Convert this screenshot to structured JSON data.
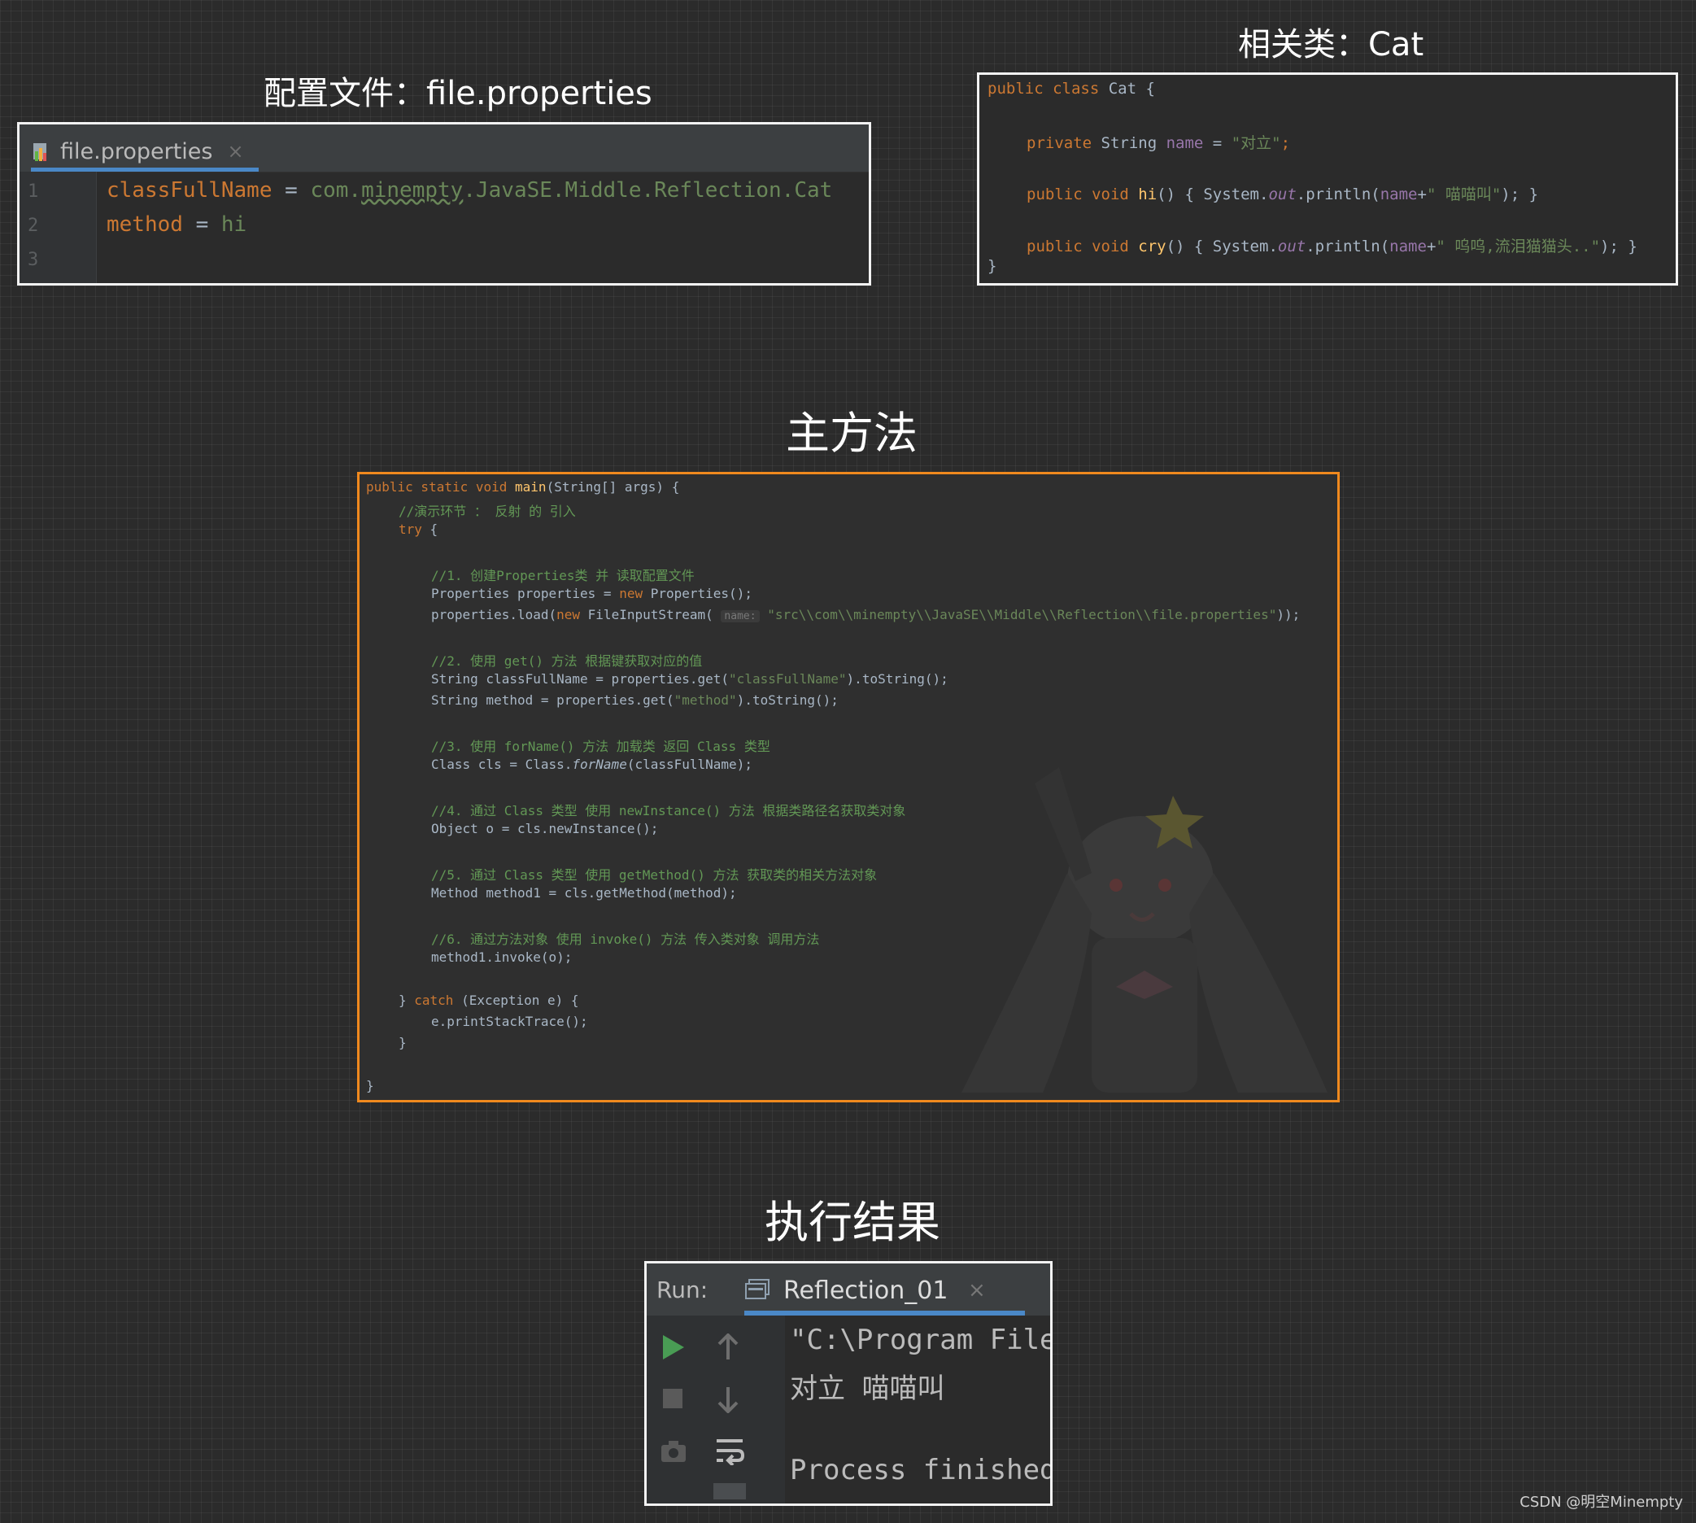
{
  "titles": {
    "config": "配置文件：file.properties",
    "cat": "相关类：Cat",
    "main": "主方法",
    "result": "执行结果"
  },
  "properties_panel": {
    "tab_label": "file.properties",
    "tab_close": "×",
    "line_numbers": [
      "1",
      "2",
      "3"
    ],
    "line1_key": "classFullName",
    "line1_eq": " = ",
    "line1_val_prefix": "com.",
    "line1_val_underlined": "minempty",
    "line1_val_suffix": ".JavaSE.Middle.Reflection.Cat",
    "line2_key": "method",
    "line2_eq": " = ",
    "line2_val": "hi"
  },
  "cat_panel": {
    "l1_kw": "public class ",
    "l1_name": "Cat {",
    "l2_kw": "private ",
    "l2_type": "String ",
    "l2_field": "name",
    "l2_eq": " = ",
    "l2_str": "\"对立\"",
    "l2_semi": ";",
    "l3_kw": "public void ",
    "l3_fn": "hi",
    "l3_a": "() { System.",
    "l3_out": "out",
    "l3_b": ".println(",
    "l3_field": "name",
    "l3_c": "+",
    "l3_str": "\" 喵喵叫\"",
    "l3_d": "); }",
    "l4_kw": "public void ",
    "l4_fn": "cry",
    "l4_a": "() { System.",
    "l4_out": "out",
    "l4_b": ".println(",
    "l4_field": "name",
    "l4_c": "+",
    "l4_str": "\" 呜呜,流泪猫猫头..\"",
    "l4_d": "); }",
    "l5": "}"
  },
  "main_panel": {
    "l1_kw": "public static void ",
    "l1_fn": "main",
    "l1_rest": "(String[] args) {",
    "l2": "//演示环节 ： 反射 的 引入",
    "l3_kw": "try",
    "l3_rest": " {",
    "l4": "//1. 创建Properties类 并 读取配置文件",
    "l5_a": "Properties properties = ",
    "l5_kw": "new",
    "l5_b": " Properties();",
    "l6_a": "properties.load(",
    "l6_kw": "new",
    "l6_b": " FileInputStream( ",
    "l6_hint": "name:",
    "l6_str": " \"src\\\\com\\\\minempty\\\\JavaSE\\\\Middle\\\\Reflection\\\\file.properties\"",
    "l6_c": "));",
    "l7": "//2. 使用 get() 方法 根据键获取对应的值",
    "l8_a": "String classFullName = properties.get(",
    "l8_str": "\"classFullName\"",
    "l8_b": ").toString();",
    "l9_a": "String method = properties.get(",
    "l9_str": "\"method\"",
    "l9_b": ").toString();",
    "l10": "//3. 使用 forName() 方法 加载类 返回 Class 类型",
    "l11_a": "Class cls = Class.",
    "l11_it": "forName",
    "l11_b": "(classFullName);",
    "l12": "//4. 通过 Class 类型 使用 newInstance() 方法 根据类路径名获取类对象",
    "l13": "Object o = cls.newInstance();",
    "l14": "//5. 通过 Class 类型 使用 getMethod() 方法 获取类的相关方法对象",
    "l15": "Method method1 = cls.getMethod(method);",
    "l16": "//6. 通过方法对象 使用 invoke() 方法 传入类对象 调用方法",
    "l17": "method1.invoke(o);",
    "l18_a": "} ",
    "l18_kw": "catch",
    "l18_b": " (Exception e) {",
    "l19": "e.printStackTrace();",
    "l20": "}",
    "l21": "}"
  },
  "run_panel": {
    "run_label": "Run:",
    "tab_label": "Reflection_01",
    "tab_close": "×",
    "out1": "\"C:\\Program Files",
    "out2": "对立 喵喵叫",
    "out3": "Process finished"
  },
  "watermark": "CSDN @明空Minempty",
  "colors": {
    "background": "#2b2b2b",
    "accent_border": "#f0891e",
    "keyword": "#cc7832",
    "string": "#6a8759",
    "comment": "#629755",
    "function": "#ffc66d",
    "field": "#9876aa",
    "run_green": "#499c54"
  },
  "icons": [
    "properties-file-icon",
    "console-tab-icon",
    "run-icon",
    "stop-icon",
    "arrow-up-icon",
    "arrow-down-icon",
    "camera-icon",
    "soft-wrap-icon"
  ]
}
